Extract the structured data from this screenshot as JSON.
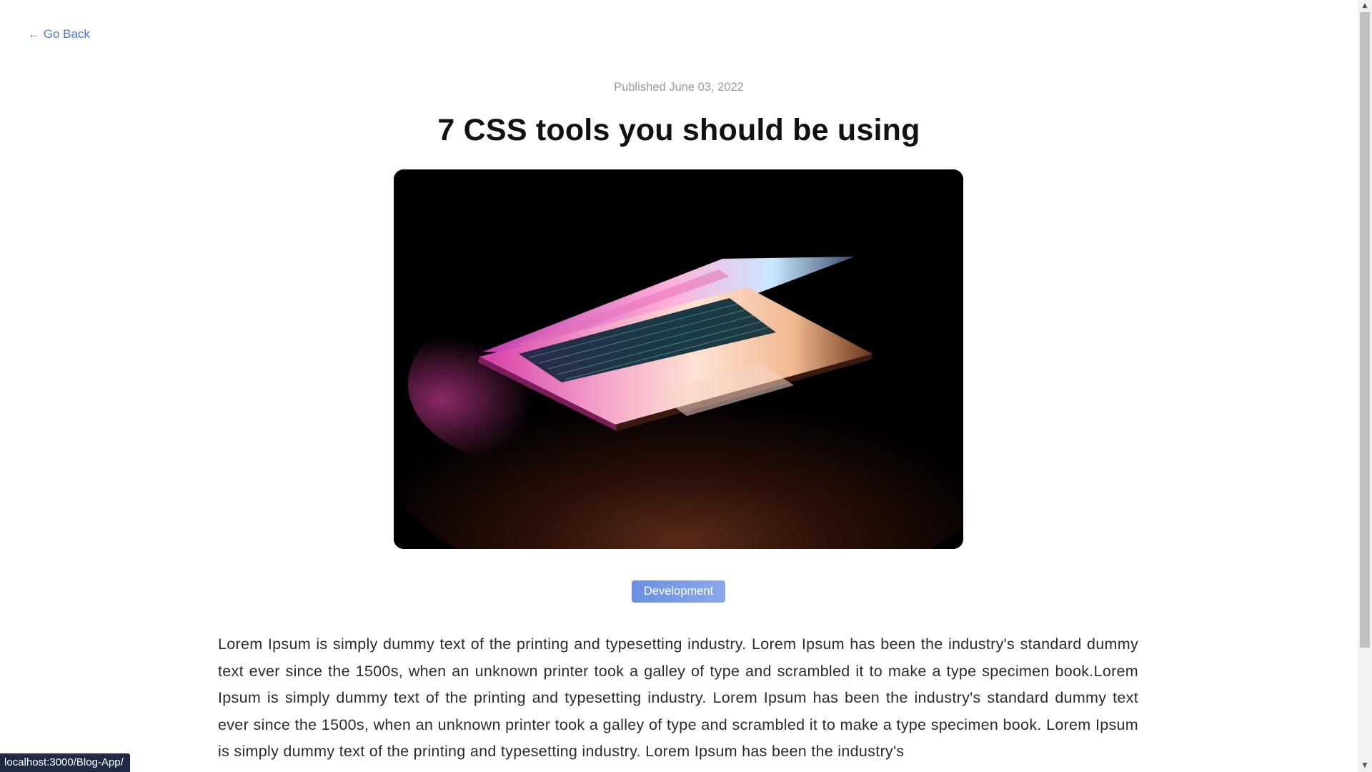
{
  "nav": {
    "go_back_label": "← Go Back"
  },
  "article": {
    "published": "Published June 03, 2022",
    "title": "7 CSS tools you should be using",
    "image_alt": "laptop",
    "tag": "Development",
    "body": "Lorem Ipsum is simply dummy text of the printing and typesetting industry. Lorem Ipsum has been the industry's standard dummy text ever since the 1500s, when an unknown printer took a galley of type and scrambled it to make a type specimen book.Lorem Ipsum is simply dummy text of the printing and typesetting industry. Lorem Ipsum has been the industry's standard dummy text ever since the 1500s, when an unknown printer took a galley of type and scrambled it to make a type specimen book. Lorem Ipsum is simply dummy text of the printing and typesetting industry. Lorem Ipsum has been the industry's"
  },
  "scrollbar": {
    "up_arrow": "▲",
    "down_arrow": "▼"
  },
  "status_bar": {
    "url": "localhost:3000/Blog-App/"
  },
  "colors": {
    "link": "#4a78d0",
    "tag_background": "#7b9ce6",
    "status_background": "#1f2a44"
  }
}
